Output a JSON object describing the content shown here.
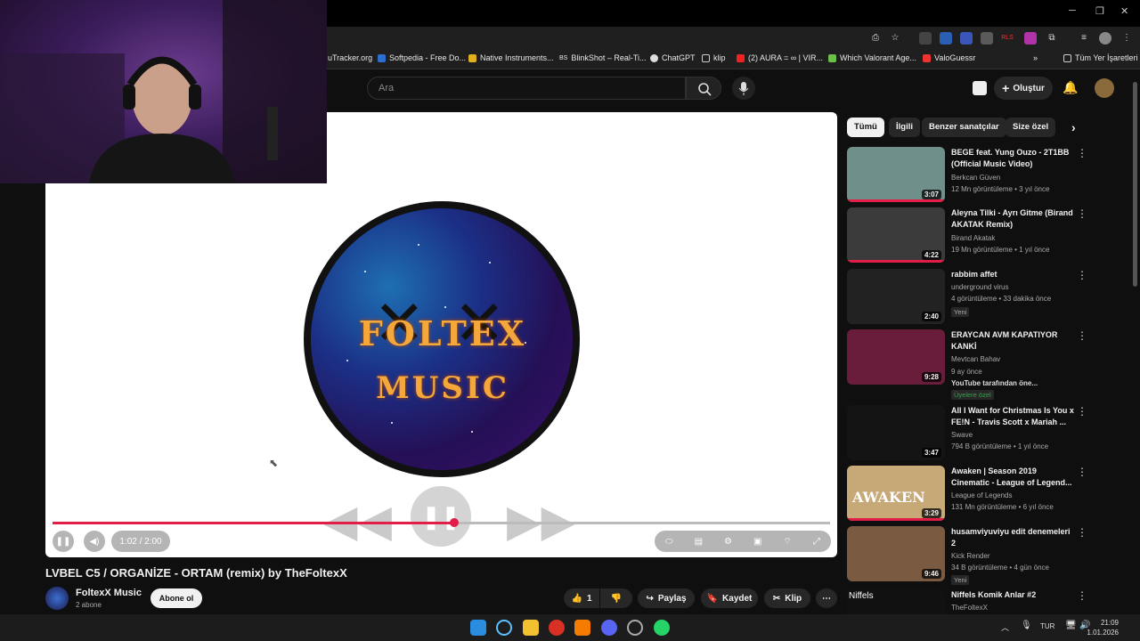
{
  "bookmarks": [
    "uTracker.org",
    "Softpedia - Free Do...",
    "Native Instruments...",
    "BlinkShot – Real-Ti...",
    "ChatGPT",
    "klip",
    "(2) AURA = ∞ | VIR...",
    "Which Valorant Age...",
    "ValoGuessr",
    "Tüm Yer İşaretleri"
  ],
  "bookmark_prefixes": {
    "blinkshot": "BS"
  },
  "search": {
    "placeholder": "Ara"
  },
  "header": {
    "create_label": "Oluştur"
  },
  "player": {
    "time": "1:02 / 2:00",
    "progress": 0.517,
    "logo_line1": "FOLTEX",
    "logo_line2": "MUSIC"
  },
  "video": {
    "title": "LVBEL C5 / ORGANİZE - ORTAM (remix) by TheFoltexX",
    "channel": "FoltexX Music",
    "subs": "2 abone",
    "subscribe_label": "Abone ol",
    "likes": "1",
    "share": "Paylaş",
    "save": "Kaydet",
    "clip": "Klip"
  },
  "chips": [
    "Tümü",
    "İlgili",
    "Benzer sanatçılar",
    "Size özel"
  ],
  "recommendations": [
    {
      "title": "BEGE feat. Yung Ouzo - 2T1BB (Official Music Video)",
      "channel": "Berkcan Güven",
      "meta": "12 Mn görüntüleme • 3 yıl önce",
      "duration": "3:07",
      "thumb": "#6f8f8a"
    },
    {
      "title": "Aleyna Tilki - Ayrı Gitme (Birand AKATAK Remix)",
      "channel": "Birand Akatak",
      "meta": "19 Mn görüntüleme • 1 yıl önce",
      "duration": "4:22",
      "thumb": "#3b3b3b"
    },
    {
      "title": "rabbim affet",
      "channel": "underground virus",
      "meta": "4 görüntüleme • 33 dakika önce",
      "duration": "2:40",
      "badge": "Yeni",
      "thumb": "#222"
    },
    {
      "title": "ERAYCAN AVM KAPATIYOR KANKİ",
      "channel": "Mevtcan Bahav",
      "meta": "9 ay önce",
      "extra": "YouTube tarafından öne...",
      "members": "Üyelere özel",
      "duration": "9:28",
      "thumb": "#6a1d3a"
    },
    {
      "title": "All I Want for Christmas Is You x FE!N - Travis Scott x Mariah ...",
      "channel": "Swave",
      "meta": "794 B görüntüleme • 1 yıl önce",
      "duration": "3:47",
      "thumb": "#141414"
    },
    {
      "title": "Awaken | Season 2019 Cinematic - League of Legend...",
      "channel": "League of Legends",
      "meta": "131 Mn görüntüleme • 6 yıl önce",
      "duration": "3:29",
      "thumb": "#c7a877",
      "overlay": "AWAKEN"
    },
    {
      "title": "husamviyuviyu edit denemeleri 2",
      "channel": "Kick Render",
      "meta": "34 B görüntüleme • 4 gün önce",
      "duration": "9:46",
      "badge": "Yeni",
      "thumb": "#7a5a40"
    },
    {
      "title": "Niffels Komik Anlar #2",
      "channel": "TheFoltexX",
      "meta": "",
      "duration": "",
      "thumb": "#111",
      "overlay": "Niffels"
    }
  ],
  "taskbar": {
    "lang": "TUR",
    "time": "21:09",
    "date": "1.01.2026"
  }
}
